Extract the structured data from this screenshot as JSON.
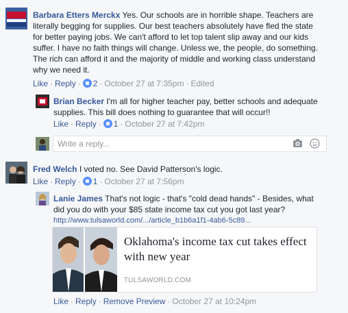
{
  "comments": [
    {
      "author": "Barbara Etters Merckx",
      "lines": [
        "Yes. Our schools are in horrible shape. Teachers are",
        "literally begging for supplies. Our best teachers absolutely have fled the state",
        "for better paying jobs. We can't afford to let top talent slip away and our kids",
        "suffer. I have no faith things will change. Unless we, the people, do something.",
        "The rich can afford it and the majority of middle and working class understand",
        "why we need it."
      ],
      "like": "Like",
      "reply": "Reply",
      "reactions": "2",
      "time": "October 27 at 7:35pm",
      "edited": "Edited"
    },
    {
      "author": "Brian Becker",
      "lines": [
        "I'm all for higher teacher pay, better schools and adequate",
        "supplies. This bill does nothing to guarantee that will occur!!"
      ],
      "like": "Like",
      "reply": "Reply",
      "reactions": "1",
      "time": "October 27 at 7:42pm"
    },
    {
      "author": "Fred Welch",
      "text": "I voted no. See David Patterson's logic.",
      "like": "Like",
      "reply": "Reply",
      "reactions": "1",
      "time": "October 27 at 7:56pm"
    },
    {
      "author": "Lanie James",
      "lines": [
        "That's not logic - that's \"cold dead hands\" - Besides, what",
        "did you do with your $85 state income tax cut you got last year?"
      ],
      "url": "http://www.tulsaworld.com/.../article_b1b6a1f1-4ab6-5c89...",
      "like": "Like",
      "reply": "Reply",
      "remove": "Remove Preview",
      "time": "October 27 at 10:24pm"
    }
  ],
  "reply_input": {
    "placeholder": "Write a reply..."
  },
  "link_preview": {
    "title_lines": [
      "Oklahoma's income tax cut takes effect",
      "with new year"
    ],
    "domain": "TULSAWORLD.COM"
  },
  "colors": {
    "name": "#365899",
    "like_badge": "#5890ff",
    "meta": "#90949c"
  }
}
